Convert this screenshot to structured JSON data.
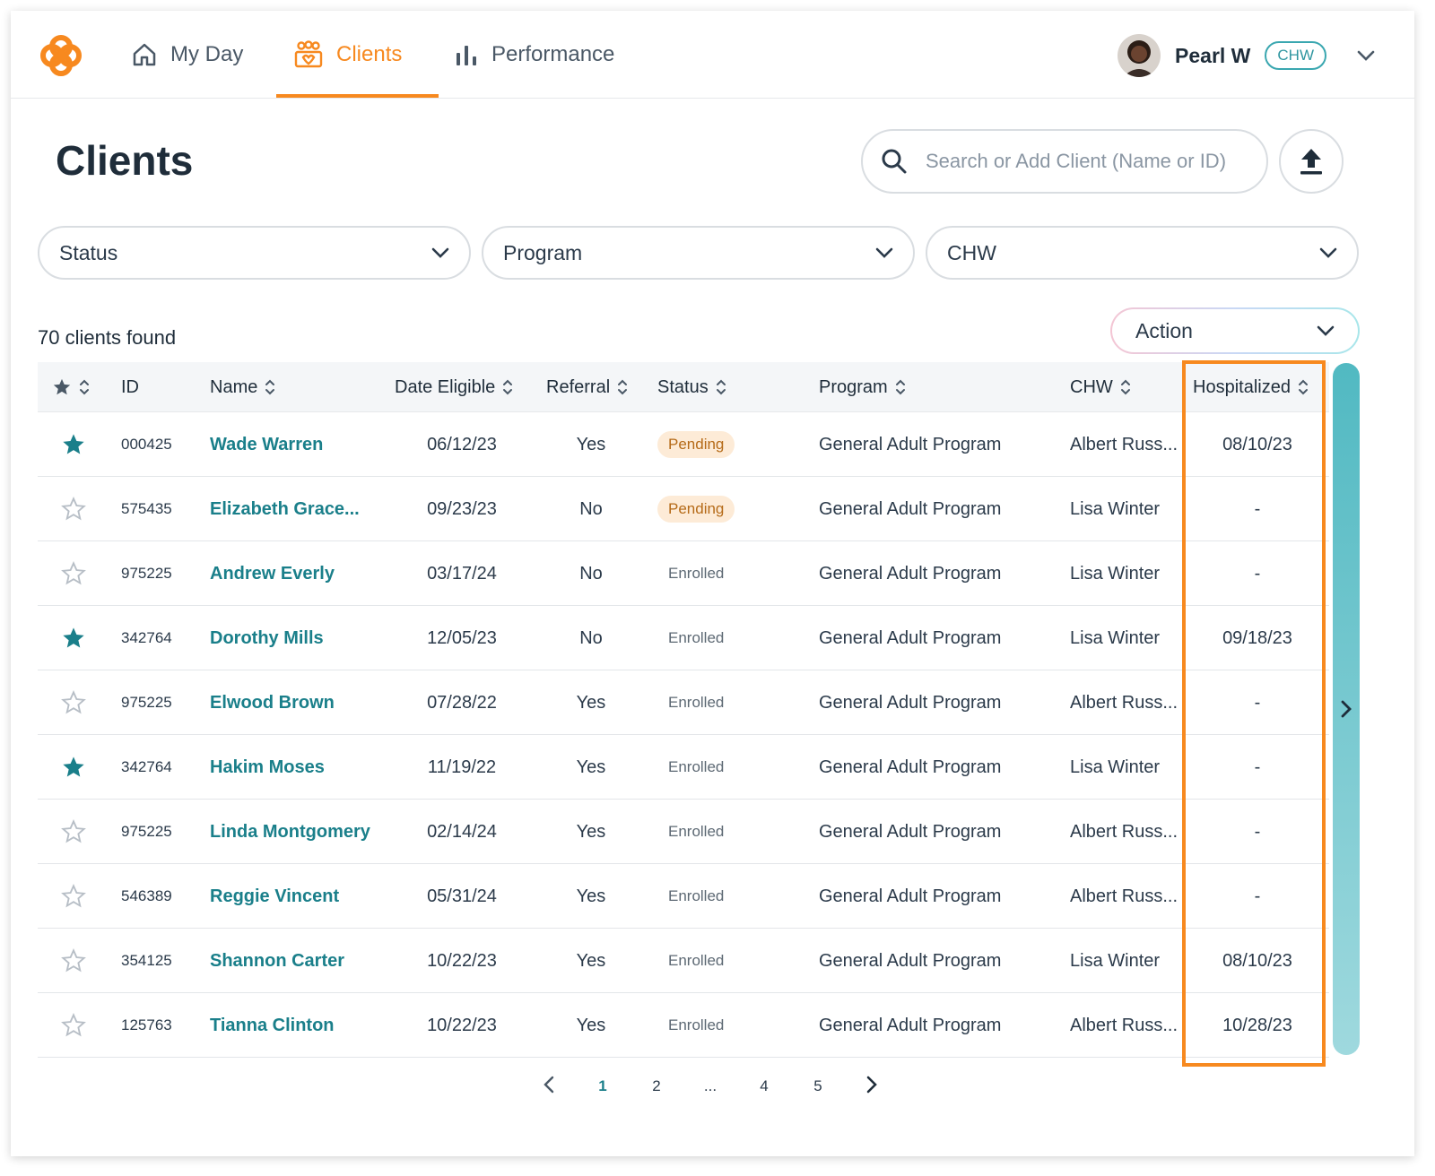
{
  "nav": {
    "items": [
      {
        "label": "My Day",
        "icon": "home-icon"
      },
      {
        "label": "Clients",
        "icon": "clients-icon"
      },
      {
        "label": "Performance",
        "icon": "bar-chart-icon"
      }
    ],
    "active": "Clients",
    "accent": "#f7891f"
  },
  "user": {
    "name": "Pearl W",
    "role": "CHW"
  },
  "page": {
    "title": "Clients",
    "search_placeholder": "Search or Add Client (Name or ID)",
    "count_text": "70 clients found",
    "action_label": "Action"
  },
  "filters": [
    {
      "label": "Status"
    },
    {
      "label": "Program"
    },
    {
      "label": "CHW"
    }
  ],
  "table": {
    "headers": {
      "id": "ID",
      "name": "Name",
      "date_eligible": "Date Eligible",
      "referral": "Referral",
      "status": "Status",
      "program": "Program",
      "chw": "CHW",
      "hospitalized": "Hospitalized"
    },
    "rows": [
      {
        "starred": true,
        "id": "000425",
        "name": "Wade Warren",
        "date_eligible": "06/12/23",
        "referral": "Yes",
        "status": "Pending",
        "program": "General Adult Program",
        "chw": "Albert Russ...",
        "hospitalized": "08/10/23"
      },
      {
        "starred": false,
        "id": "575435",
        "name": "Elizabeth Grace...",
        "date_eligible": "09/23/23",
        "referral": "No",
        "status": "Pending",
        "program": "General Adult Program",
        "chw": "Lisa Winter",
        "hospitalized": "-"
      },
      {
        "starred": false,
        "id": "975225",
        "name": "Andrew Everly",
        "date_eligible": "03/17/24",
        "referral": "No",
        "status": "Enrolled",
        "program": "General Adult Program",
        "chw": "Lisa Winter",
        "hospitalized": "-"
      },
      {
        "starred": true,
        "id": "342764",
        "name": "Dorothy Mills",
        "date_eligible": "12/05/23",
        "referral": "No",
        "status": "Enrolled",
        "program": "General Adult Program",
        "chw": "Lisa Winter",
        "hospitalized": "09/18/23"
      },
      {
        "starred": false,
        "id": "975225",
        "name": "Elwood Brown",
        "date_eligible": "07/28/22",
        "referral": "Yes",
        "status": "Enrolled",
        "program": "General Adult Program",
        "chw": "Albert Russ...",
        "hospitalized": "-"
      },
      {
        "starred": true,
        "id": "342764",
        "name": "Hakim Moses",
        "date_eligible": "11/19/22",
        "referral": "Yes",
        "status": "Enrolled",
        "program": "General Adult Program",
        "chw": "Lisa Winter",
        "hospitalized": "-"
      },
      {
        "starred": false,
        "id": "975225",
        "name": "Linda Montgomery",
        "date_eligible": "02/14/24",
        "referral": "Yes",
        "status": "Enrolled",
        "program": "General Adult Program",
        "chw": "Albert Russ...",
        "hospitalized": "-"
      },
      {
        "starred": false,
        "id": "546389",
        "name": "Reggie Vincent",
        "date_eligible": "05/31/24",
        "referral": "Yes",
        "status": "Enrolled",
        "program": "General Adult Program",
        "chw": "Albert Russ...",
        "hospitalized": "-"
      },
      {
        "starred": false,
        "id": "354125",
        "name": "Shannon Carter",
        "date_eligible": "10/22/23",
        "referral": "Yes",
        "status": "Enrolled",
        "program": "General Adult Program",
        "chw": "Lisa Winter",
        "hospitalized": "08/10/23"
      },
      {
        "starred": false,
        "id": "125763",
        "name": "Tianna Clinton",
        "date_eligible": "10/22/23",
        "referral": "Yes",
        "status": "Enrolled",
        "program": "General Adult Program",
        "chw": "Albert Russ...",
        "hospitalized": "10/28/23"
      }
    ]
  },
  "pagination": {
    "pages": [
      "1",
      "2",
      "...",
      "4",
      "5"
    ],
    "current": "1"
  },
  "colors": {
    "accent": "#f7891f",
    "teal": "#1a7f8a",
    "pending_bg": "#fdebd7",
    "highlight": "#f7891f"
  }
}
